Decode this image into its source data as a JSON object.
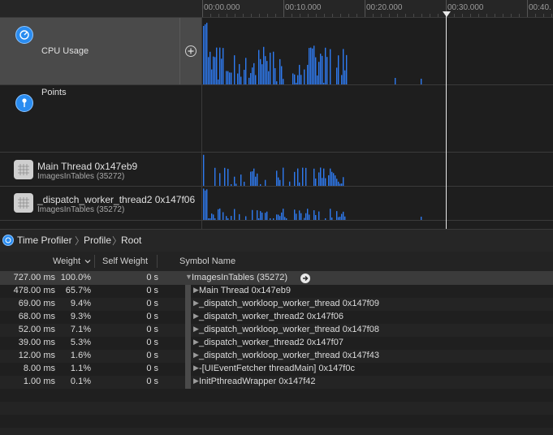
{
  "ruler": {
    "ticks": [
      "00:00.000",
      "00:10.000",
      "00:20.000",
      "00:30.000",
      "00:40."
    ]
  },
  "tracks": {
    "cpu": {
      "title": "CPU Usage",
      "icon": "gauge-icon",
      "add_icon": "plus-circle-icon"
    },
    "points": {
      "title": "Points",
      "icon": "pin-icon"
    },
    "main_thread": {
      "title": "Main Thread  0x147eb9",
      "subtitle": "ImagesInTables (35272)",
      "icon": "thread-grid-icon"
    },
    "worker_thread": {
      "title": "_dispatch_worker_thread2  0x147f06",
      "subtitle": "ImagesInTables (35272)",
      "icon": "thread-grid-icon"
    }
  },
  "breadcrumb": {
    "items": [
      "Time Profiler",
      "Profile",
      "Root"
    ]
  },
  "table": {
    "headers": {
      "weight": "Weight",
      "self_weight": "Self Weight",
      "symbol": "Symbol Name"
    },
    "rows": [
      {
        "weight": "727.00 ms",
        "percent": "100.0%",
        "self": "0 s",
        "symbol": "ImagesInTables (35272)",
        "expanded": true,
        "selected": true
      },
      {
        "weight": "478.00 ms",
        "percent": "65.7%",
        "self": "0 s",
        "symbol": "Main Thread  0x147eb9"
      },
      {
        "weight": "69.00 ms",
        "percent": "9.4%",
        "self": "0 s",
        "symbol": "_dispatch_workloop_worker_thread  0x147f09"
      },
      {
        "weight": "68.00 ms",
        "percent": "9.3%",
        "self": "0 s",
        "symbol": "_dispatch_worker_thread2  0x147f06"
      },
      {
        "weight": "52.00 ms",
        "percent": "7.1%",
        "self": "0 s",
        "symbol": "_dispatch_workloop_worker_thread  0x147f08"
      },
      {
        "weight": "39.00 ms",
        "percent": "5.3%",
        "self": "0 s",
        "symbol": "_dispatch_worker_thread2  0x147f07"
      },
      {
        "weight": "12.00 ms",
        "percent": "1.6%",
        "self": "0 s",
        "symbol": "_dispatch_workloop_worker_thread  0x147f43"
      },
      {
        "weight": "8.00 ms",
        "percent": "1.1%",
        "self": "0 s",
        "symbol": "-[UIEventFetcher threadMain]  0x147f0c"
      },
      {
        "weight": "1.00 ms",
        "percent": "0.1%",
        "self": "0 s",
        "symbol": "InitPthreadWrapper  0x147f42"
      }
    ]
  },
  "colors": {
    "bar": "#2f7bf0",
    "accent": "#2a8cf0"
  }
}
